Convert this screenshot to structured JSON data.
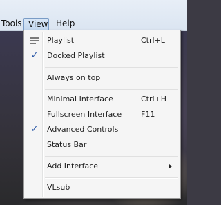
{
  "menubar": {
    "tools_label": "Tools",
    "view_label": "View",
    "help_label": "Help"
  },
  "view_menu": {
    "playlist": {
      "label": "Playlist",
      "shortcut": "Ctrl+L",
      "icon": "playlist-icon"
    },
    "docked_playlist": {
      "label": "Docked Playlist",
      "checked": true
    },
    "always_on_top": {
      "label": "Always on top"
    },
    "minimal_interface": {
      "label": "Minimal Interface",
      "shortcut": "Ctrl+H"
    },
    "fullscreen_interface": {
      "label": "Fullscreen Interface",
      "shortcut": "F11"
    },
    "advanced_controls": {
      "label": "Advanced Controls",
      "checked": true
    },
    "status_bar": {
      "label": "Status Bar"
    },
    "add_interface": {
      "label": "Add Interface",
      "has_submenu": true
    },
    "vlsub": {
      "label": "VLsub"
    }
  },
  "colors": {
    "menu_bg": "#f5f5f5",
    "check": "#2d5aa8",
    "menubar_bg": "#dbe5f1"
  }
}
